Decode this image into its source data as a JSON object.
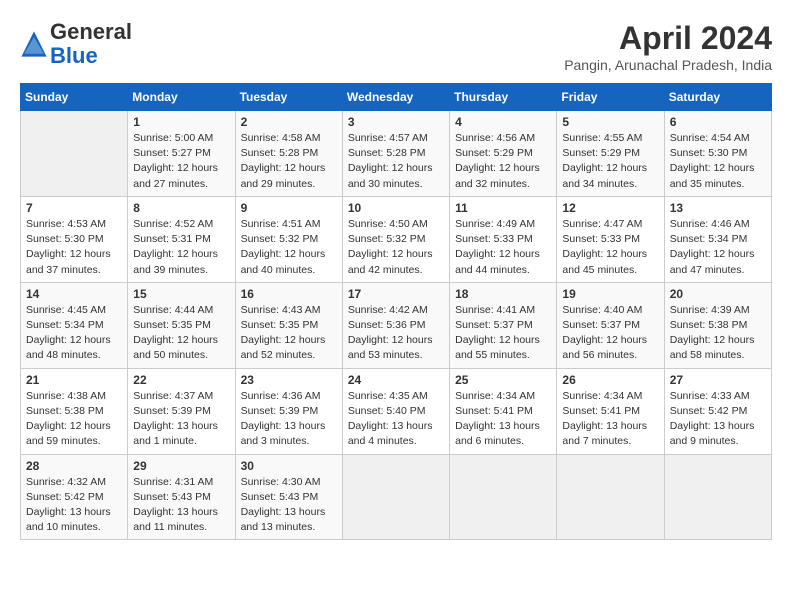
{
  "header": {
    "logo_line1": "General",
    "logo_line2": "Blue",
    "month_year": "April 2024",
    "location": "Pangin, Arunachal Pradesh, India"
  },
  "weekdays": [
    "Sunday",
    "Monday",
    "Tuesday",
    "Wednesday",
    "Thursday",
    "Friday",
    "Saturday"
  ],
  "weeks": [
    [
      {
        "day": "",
        "info": ""
      },
      {
        "day": "1",
        "info": "Sunrise: 5:00 AM\nSunset: 5:27 PM\nDaylight: 12 hours\nand 27 minutes."
      },
      {
        "day": "2",
        "info": "Sunrise: 4:58 AM\nSunset: 5:28 PM\nDaylight: 12 hours\nand 29 minutes."
      },
      {
        "day": "3",
        "info": "Sunrise: 4:57 AM\nSunset: 5:28 PM\nDaylight: 12 hours\nand 30 minutes."
      },
      {
        "day": "4",
        "info": "Sunrise: 4:56 AM\nSunset: 5:29 PM\nDaylight: 12 hours\nand 32 minutes."
      },
      {
        "day": "5",
        "info": "Sunrise: 4:55 AM\nSunset: 5:29 PM\nDaylight: 12 hours\nand 34 minutes."
      },
      {
        "day": "6",
        "info": "Sunrise: 4:54 AM\nSunset: 5:30 PM\nDaylight: 12 hours\nand 35 minutes."
      }
    ],
    [
      {
        "day": "7",
        "info": "Sunrise: 4:53 AM\nSunset: 5:30 PM\nDaylight: 12 hours\nand 37 minutes."
      },
      {
        "day": "8",
        "info": "Sunrise: 4:52 AM\nSunset: 5:31 PM\nDaylight: 12 hours\nand 39 minutes."
      },
      {
        "day": "9",
        "info": "Sunrise: 4:51 AM\nSunset: 5:32 PM\nDaylight: 12 hours\nand 40 minutes."
      },
      {
        "day": "10",
        "info": "Sunrise: 4:50 AM\nSunset: 5:32 PM\nDaylight: 12 hours\nand 42 minutes."
      },
      {
        "day": "11",
        "info": "Sunrise: 4:49 AM\nSunset: 5:33 PM\nDaylight: 12 hours\nand 44 minutes."
      },
      {
        "day": "12",
        "info": "Sunrise: 4:47 AM\nSunset: 5:33 PM\nDaylight: 12 hours\nand 45 minutes."
      },
      {
        "day": "13",
        "info": "Sunrise: 4:46 AM\nSunset: 5:34 PM\nDaylight: 12 hours\nand 47 minutes."
      }
    ],
    [
      {
        "day": "14",
        "info": "Sunrise: 4:45 AM\nSunset: 5:34 PM\nDaylight: 12 hours\nand 48 minutes."
      },
      {
        "day": "15",
        "info": "Sunrise: 4:44 AM\nSunset: 5:35 PM\nDaylight: 12 hours\nand 50 minutes."
      },
      {
        "day": "16",
        "info": "Sunrise: 4:43 AM\nSunset: 5:35 PM\nDaylight: 12 hours\nand 52 minutes."
      },
      {
        "day": "17",
        "info": "Sunrise: 4:42 AM\nSunset: 5:36 PM\nDaylight: 12 hours\nand 53 minutes."
      },
      {
        "day": "18",
        "info": "Sunrise: 4:41 AM\nSunset: 5:37 PM\nDaylight: 12 hours\nand 55 minutes."
      },
      {
        "day": "19",
        "info": "Sunrise: 4:40 AM\nSunset: 5:37 PM\nDaylight: 12 hours\nand 56 minutes."
      },
      {
        "day": "20",
        "info": "Sunrise: 4:39 AM\nSunset: 5:38 PM\nDaylight: 12 hours\nand 58 minutes."
      }
    ],
    [
      {
        "day": "21",
        "info": "Sunrise: 4:38 AM\nSunset: 5:38 PM\nDaylight: 12 hours\nand 59 minutes."
      },
      {
        "day": "22",
        "info": "Sunrise: 4:37 AM\nSunset: 5:39 PM\nDaylight: 13 hours\nand 1 minute."
      },
      {
        "day": "23",
        "info": "Sunrise: 4:36 AM\nSunset: 5:39 PM\nDaylight: 13 hours\nand 3 minutes."
      },
      {
        "day": "24",
        "info": "Sunrise: 4:35 AM\nSunset: 5:40 PM\nDaylight: 13 hours\nand 4 minutes."
      },
      {
        "day": "25",
        "info": "Sunrise: 4:34 AM\nSunset: 5:41 PM\nDaylight: 13 hours\nand 6 minutes."
      },
      {
        "day": "26",
        "info": "Sunrise: 4:34 AM\nSunset: 5:41 PM\nDaylight: 13 hours\nand 7 minutes."
      },
      {
        "day": "27",
        "info": "Sunrise: 4:33 AM\nSunset: 5:42 PM\nDaylight: 13 hours\nand 9 minutes."
      }
    ],
    [
      {
        "day": "28",
        "info": "Sunrise: 4:32 AM\nSunset: 5:42 PM\nDaylight: 13 hours\nand 10 minutes."
      },
      {
        "day": "29",
        "info": "Sunrise: 4:31 AM\nSunset: 5:43 PM\nDaylight: 13 hours\nand 11 minutes."
      },
      {
        "day": "30",
        "info": "Sunrise: 4:30 AM\nSunset: 5:43 PM\nDaylight: 13 hours\nand 13 minutes."
      },
      {
        "day": "",
        "info": ""
      },
      {
        "day": "",
        "info": ""
      },
      {
        "day": "",
        "info": ""
      },
      {
        "day": "",
        "info": ""
      }
    ]
  ]
}
